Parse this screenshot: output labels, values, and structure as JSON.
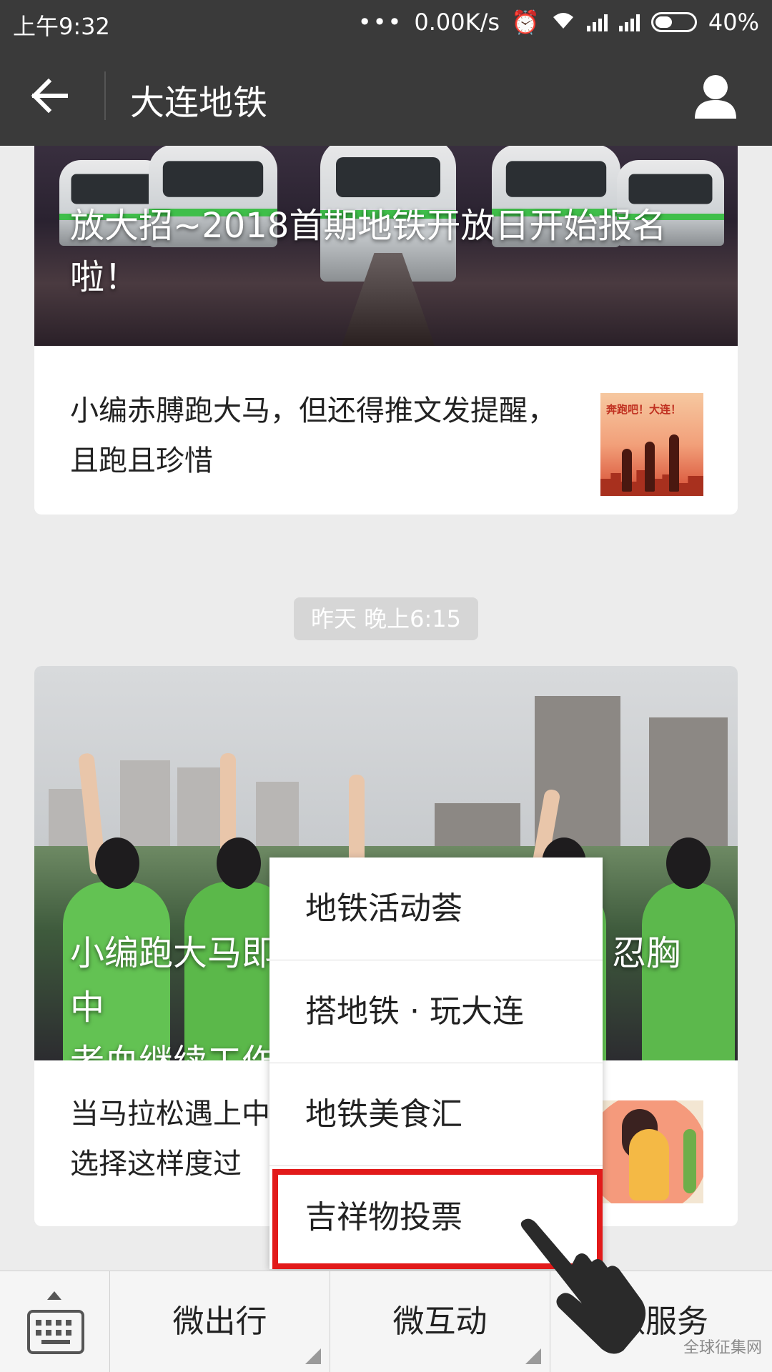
{
  "status_bar": {
    "time": "上午9:32",
    "network_speed": "0.00K/s",
    "battery": "40%",
    "icons": [
      "more-dots-icon",
      "alarm-icon",
      "wifi-icon",
      "signal-icon",
      "signal-icon",
      "battery-icon"
    ]
  },
  "nav": {
    "title": "大连地铁",
    "back_icon": "back-arrow-icon",
    "profile_icon": "user-icon"
  },
  "articles_top": {
    "hero_title": "放大招~2018首期地铁开放日开始报名啦！",
    "items": [
      {
        "text": "小编赤膊跑大马，但还得推文发提醒，且跑且珍惜",
        "thumb_caption": "奔跑吧！大连！"
      }
    ]
  },
  "timestamp": "昨天 晚上6:15",
  "articles_bottom": {
    "hero_title_left": "小编跑大马即",
    "hero_title_right": "忍胸中",
    "hero_title_line2": "老血继续工作",
    "items": [
      {
        "text": "当马拉松遇上中\n选择这样度过"
      }
    ]
  },
  "popup_menu": {
    "items": [
      {
        "label": "地铁活动荟"
      },
      {
        "label": "搭地铁 · 玩大连"
      },
      {
        "label": "地铁美食汇"
      },
      {
        "label": "吉祥物投票"
      }
    ],
    "highlighted_index": 3,
    "highlight_color": "#e21a1a"
  },
  "bottom_menu": {
    "tabs": [
      {
        "label": "微出行"
      },
      {
        "label": "微互动"
      },
      {
        "label": "微服务"
      }
    ]
  },
  "watermark": "全球征集网",
  "colors": {
    "header_bg": "#3a3a3a",
    "accent_red": "#e21a1a",
    "page_bg": "#ececec"
  }
}
